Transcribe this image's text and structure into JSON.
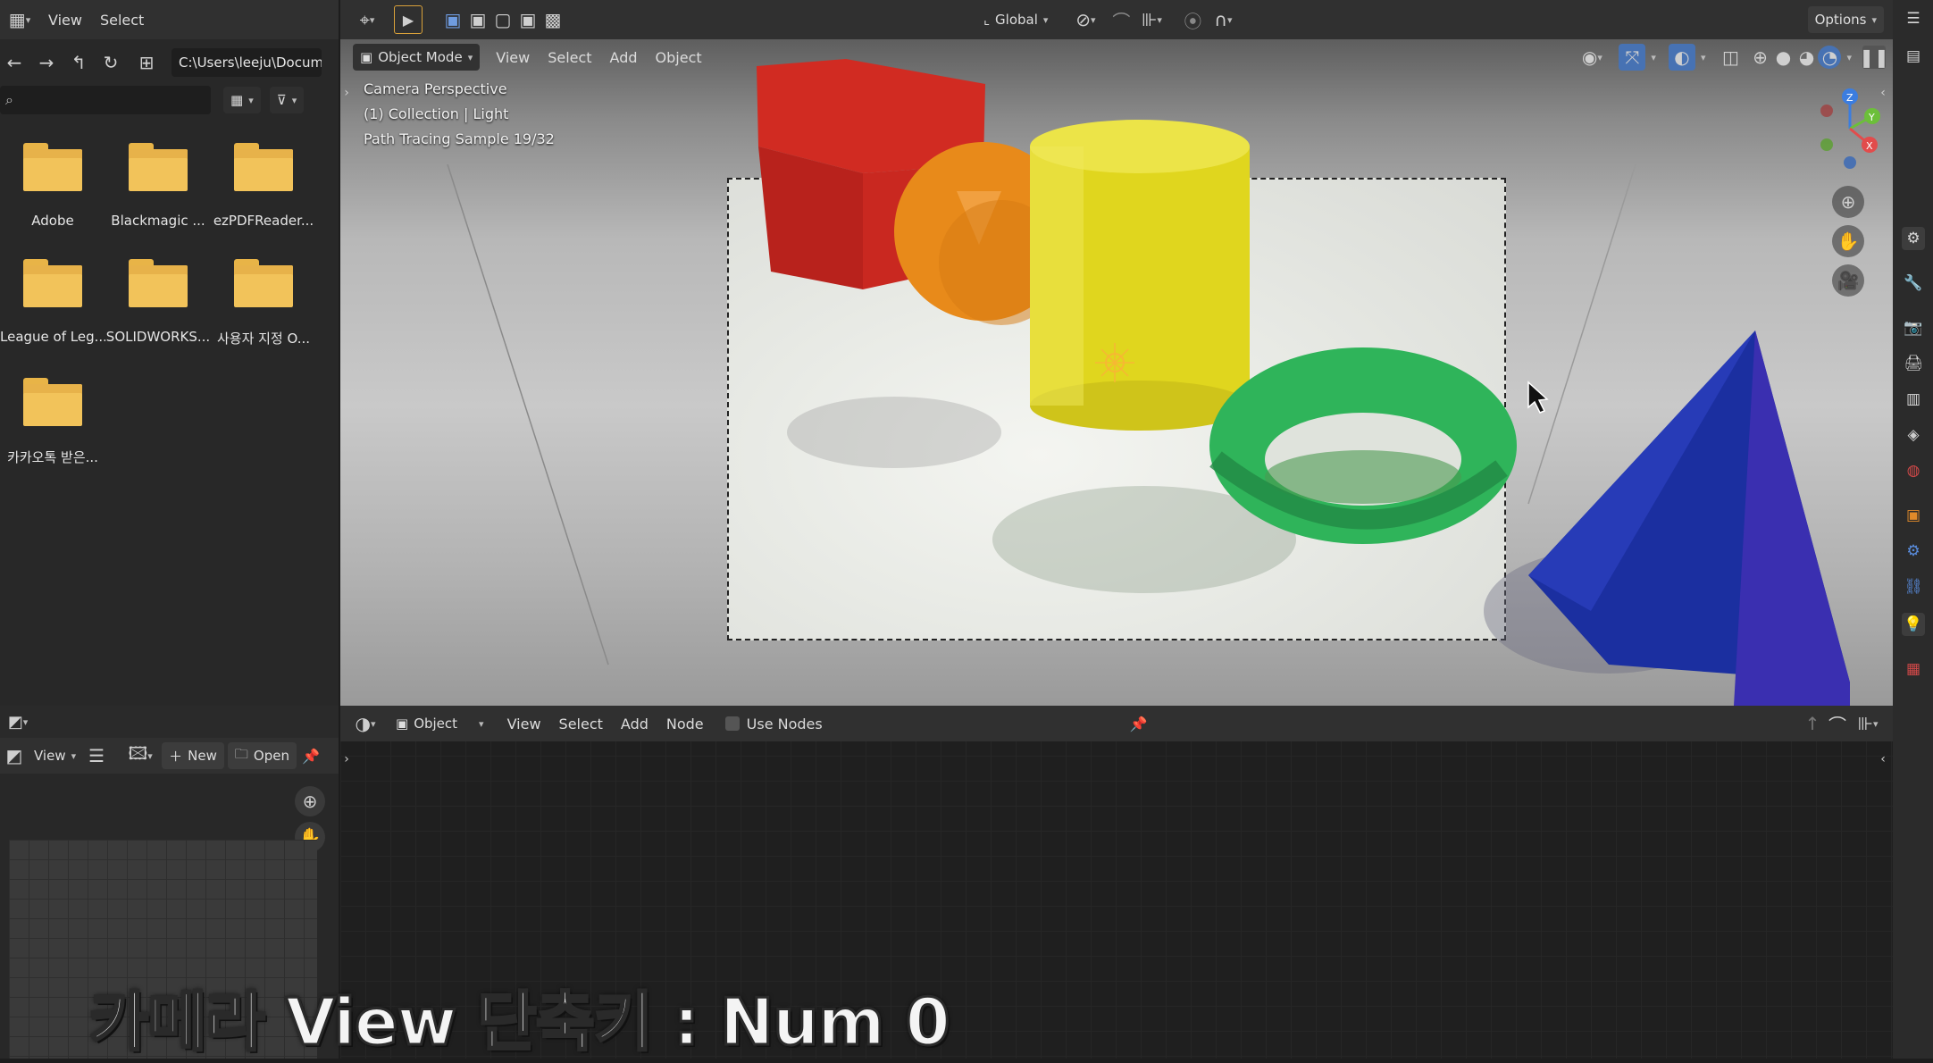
{
  "file_browser": {
    "menu": [
      "View",
      "Select"
    ],
    "path": "C:\\Users\\leeju\\Docum...",
    "search_placeholder": "",
    "folders": [
      {
        "label": "Adobe"
      },
      {
        "label": "Blackmagic ..."
      },
      {
        "label": "ezPDFReader..."
      },
      {
        "label": "League of Leg..."
      },
      {
        "label": "SOLIDWORKS..."
      },
      {
        "label": "사용자 지정 O..."
      },
      {
        "label": "카카오톡 받은..."
      }
    ]
  },
  "top_toolbar": {
    "orientation": "Global",
    "options": "Options"
  },
  "viewport": {
    "mode": "Object Mode",
    "menu": [
      "View",
      "Select",
      "Add",
      "Object"
    ],
    "overlay_lines": [
      "Camera Perspective",
      "(1) Collection | Light",
      "Path Tracing Sample 19/32"
    ],
    "gizmo_axes": {
      "z": "Z",
      "y": "Y",
      "x": "X"
    }
  },
  "image_editor": {
    "view_label": "View",
    "new_label": "New",
    "open_label": "Open"
  },
  "node_editor": {
    "object_label": "Object",
    "menu": [
      "View",
      "Select",
      "Add",
      "Node"
    ],
    "use_nodes_label": "Use Nodes"
  },
  "caption": "카메라 View 단축키 : Num 0",
  "colors": {
    "accent_blue": "#4772b3",
    "folder_yellow": "#f2c35a",
    "panel_bg": "#282828",
    "header_bg": "#303030"
  }
}
